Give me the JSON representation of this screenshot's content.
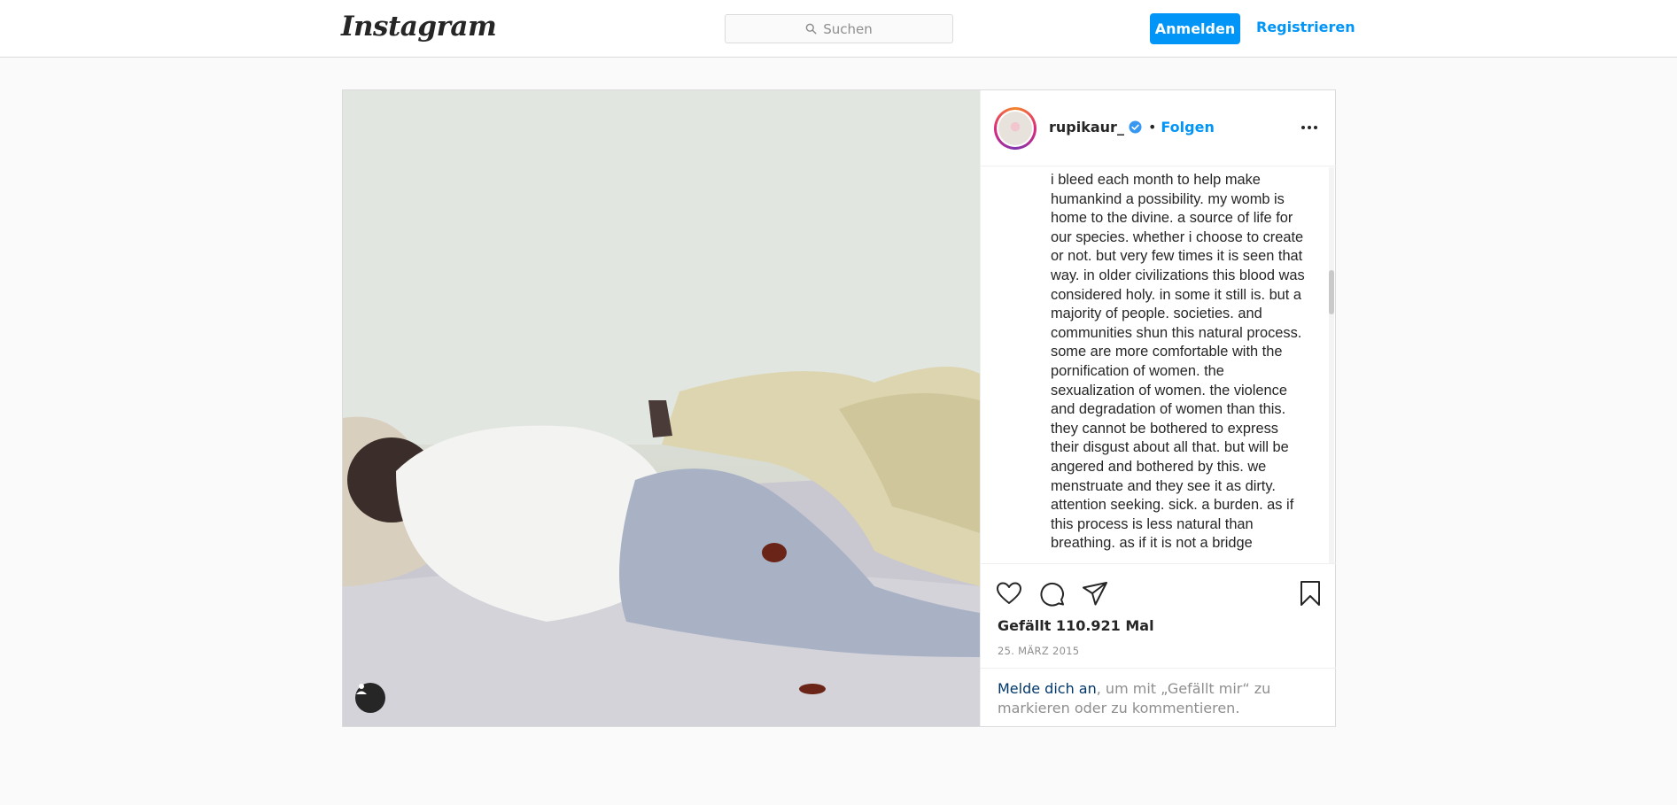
{
  "header": {
    "logo_text": "Instagram",
    "search_placeholder": "Suchen",
    "login_label": "Anmelden",
    "register_label": "Registrieren"
  },
  "post": {
    "username": "rupikaur_",
    "verified": true,
    "dot": "•",
    "follow_label": "Folgen",
    "caption": "i bleed each month to help make humankind a possibility. my womb is home to the divine. a source of life for our species. whether i choose to create or not. but very few times it is seen that way. in older civilizations this blood was considered holy. in some it still is. but a majority of people. societies. and communities shun this natural process. some are more comfortable with the pornification of women. the sexualization of women. the violence and degradation of women than this. they cannot be bothered to express their disgust about all that. but will be angered and bothered by this. we menstruate and they see it as dirty. attention seeking. sick. a burden. as if this process is less natural than breathing. as if it is not a bridge",
    "likes_text": "Gefällt 110.921 Mal",
    "date_text": "25. MÄRZ 2015",
    "login_prompt": {
      "link": "Melde dich an",
      "rest": ", um mit „Gefällt mir“ zu markieren oder zu kommentieren."
    }
  },
  "icons": [
    "search-icon",
    "verified-badge-icon",
    "more-options-icon",
    "heart-icon",
    "comment-icon",
    "share-icon",
    "bookmark-icon",
    "user-tag-icon"
  ],
  "colors": {
    "accent": "#0095f6",
    "link_dark": "#00376b",
    "muted": "#8e8e8e",
    "text": "#262626",
    "border": "#dbdbdb",
    "background": "#fafafa"
  }
}
